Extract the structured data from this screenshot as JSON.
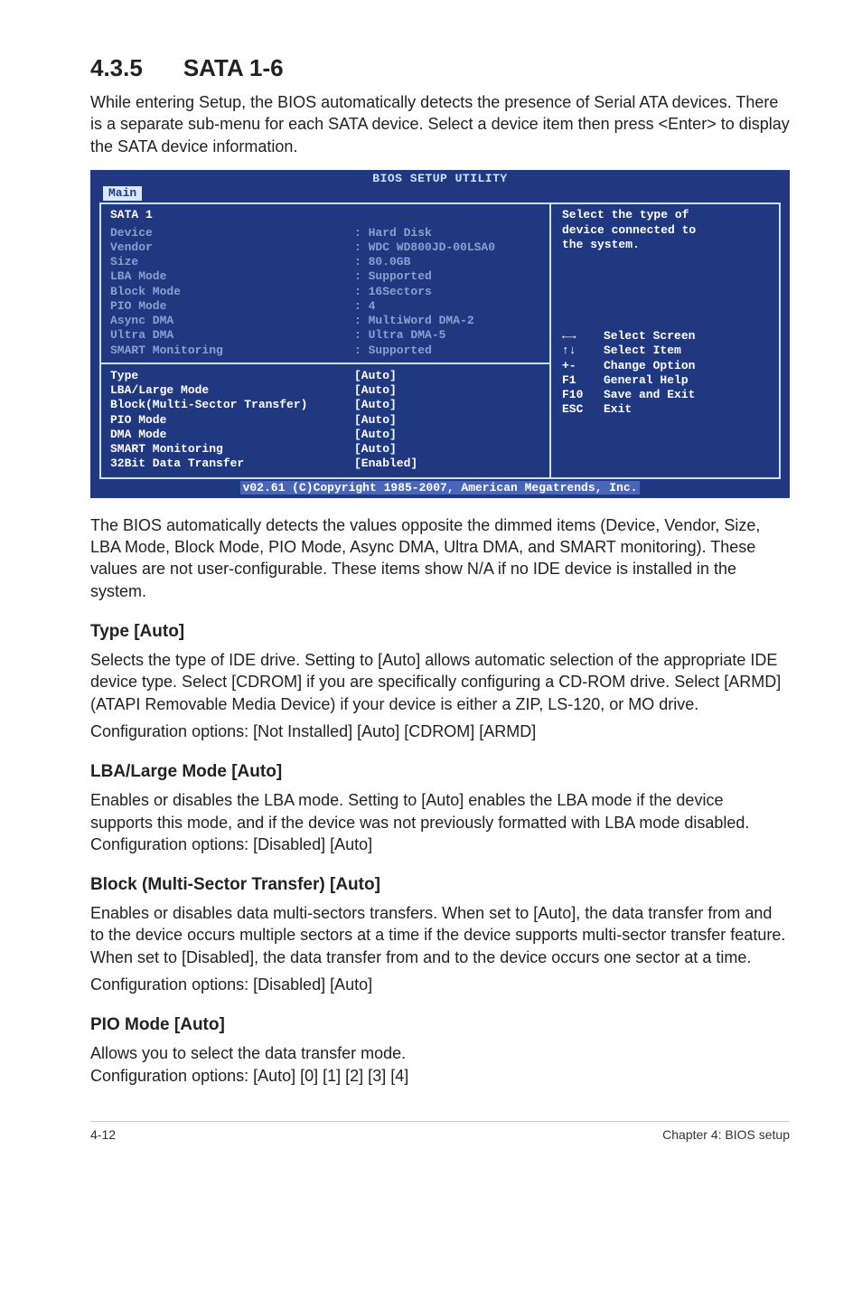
{
  "heading": {
    "number": "4.3.5",
    "title": "SATA 1-6"
  },
  "intro": "While entering Setup, the BIOS automatically detects the presence of Serial ATA devices. There is a separate sub-menu for each SATA device. Select a device item then press <Enter> to display the SATA device information.",
  "bios": {
    "title": "BIOS SETUP UTILITY",
    "tab": "Main",
    "left_title": "SATA 1",
    "dimmed": [
      {
        "lbl": "Device          ",
        "val": ": Hard Disk"
      },
      {
        "lbl": "Vendor          ",
        "val": ": WDC WD800JD-00LSA0"
      },
      {
        "lbl": "Size            ",
        "val": ": 80.0GB"
      },
      {
        "lbl": "LBA Mode        ",
        "val": ": Supported"
      },
      {
        "lbl": "Block Mode      ",
        "val": ": 16Sectors"
      },
      {
        "lbl": "PIO Mode        ",
        "val": ": 4"
      },
      {
        "lbl": "Async DMA       ",
        "val": ": MultiWord DMA-2"
      },
      {
        "lbl": "Ultra DMA       ",
        "val": ": Ultra DMA-5"
      },
      {
        "lbl": "SMART Monitoring",
        "val": ": Supported"
      }
    ],
    "items": [
      {
        "lbl": "Type",
        "val": "[Auto]"
      },
      {
        "lbl": "LBA/Large Mode",
        "val": "[Auto]"
      },
      {
        "lbl": "Block(Multi-Sector Transfer)",
        "val": "[Auto]"
      },
      {
        "lbl": "PIO Mode",
        "val": "[Auto]"
      },
      {
        "lbl": "DMA Mode",
        "val": "[Auto]"
      },
      {
        "lbl": "SMART Monitoring",
        "val": "[Auto]"
      },
      {
        "lbl": "32Bit Data Transfer",
        "val": "[Enabled]"
      }
    ],
    "help": "Select the type of\ndevice connected to\nthe system.",
    "keys": [
      {
        "k": "←→",
        "d": "Select Screen"
      },
      {
        "k": "↑↓",
        "d": "Select Item"
      },
      {
        "k": "+-",
        "d": "Change Option"
      },
      {
        "k": "F1",
        "d": "General Help"
      },
      {
        "k": "F10",
        "d": "Save and Exit"
      },
      {
        "k": "ESC",
        "d": "Exit"
      }
    ],
    "footer": "v02.61 (C)Copyright 1985-2007, American Megatrends, Inc."
  },
  "after_bios": "The BIOS automatically detects the values opposite the dimmed items (Device, Vendor, Size, LBA Mode, Block Mode, PIO Mode, Async DMA, Ultra DMA, and SMART monitoring). These values are not user-configurable. These items show N/A if no IDE device is installed in the system.",
  "sections": {
    "type": {
      "h": "Type [Auto]",
      "p1": "Selects the type of IDE drive. Setting to [Auto] allows automatic selection of the appropriate IDE device type. Select [CDROM] if you are specifically configuring a CD-ROM drive. Select [ARMD] (ATAPI Removable Media Device) if your device is either a ZIP, LS-120, or MO drive.",
      "p2": "Configuration options: [Not Installed] [Auto] [CDROM] [ARMD]"
    },
    "lba": {
      "h": "LBA/Large Mode [Auto]",
      "p": "Enables or disables the LBA mode. Setting to [Auto] enables the LBA mode if the device supports this mode, and if the device was not previously formatted with LBA mode disabled. Configuration options: [Disabled] [Auto]"
    },
    "block": {
      "h": "Block (Multi-Sector Transfer) [Auto]",
      "p1": "Enables or disables data multi-sectors transfers. When set to [Auto], the data transfer from and to the device occurs multiple sectors at a time if the device supports multi-sector transfer feature. When set to [Disabled], the data transfer from and to the device occurs one sector at a time.",
      "p2": "Configuration options: [Disabled] [Auto]"
    },
    "pio": {
      "h": "PIO Mode [Auto]",
      "p1": "Allows you to select the data transfer mode.",
      "p2": "Configuration options: [Auto] [0] [1] [2] [3] [4]"
    }
  },
  "footer": {
    "left": "4-12",
    "right": "Chapter 4: BIOS setup"
  }
}
